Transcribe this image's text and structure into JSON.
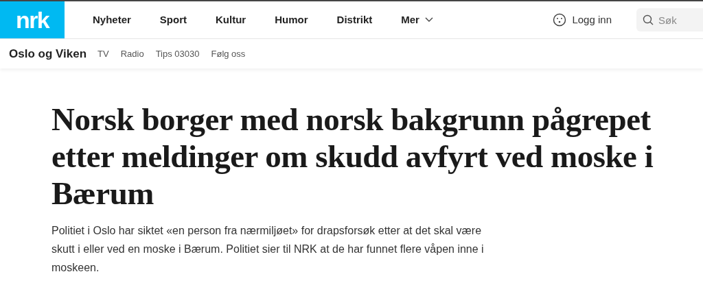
{
  "logo": "nrk",
  "nav": [
    {
      "label": "Nyheter"
    },
    {
      "label": "Sport"
    },
    {
      "label": "Kultur"
    },
    {
      "label": "Humor"
    },
    {
      "label": "Distrikt"
    },
    {
      "label": "Mer"
    }
  ],
  "login": "Logg inn",
  "search": {
    "placeholder": "Søk"
  },
  "subnav": {
    "title": "Oslo og Viken",
    "links": [
      "TV",
      "Radio",
      "Tips 03030",
      "Følg oss"
    ]
  },
  "article": {
    "headline": "Norsk borger med norsk bakgrunn pågrepet etter meldinger om skudd avfyrt ved moske i Bærum",
    "lead": "Politiet i Oslo har siktet «en person fra nærmiljøet» for drapsforsøk etter at det skal være skutt i eller ved en moske i Bærum. Politiet sier til NRK at de har funnet flere våpen inne i moskeen."
  }
}
